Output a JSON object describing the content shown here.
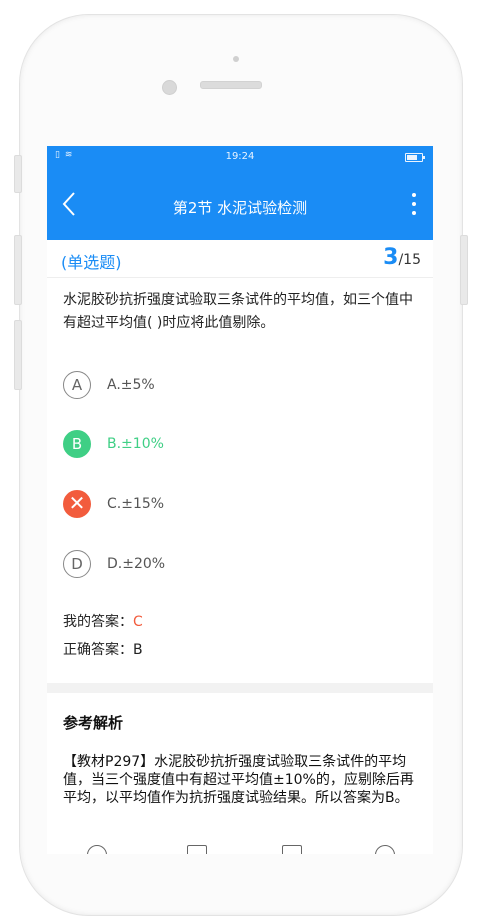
{
  "status_bar": {
    "left_icons": "▯ ≋",
    "time": "19:24"
  },
  "navbar": {
    "title": "第2节 水泥试验检测"
  },
  "question": {
    "type_label": "(单选题)",
    "current": "3",
    "total": "/15",
    "text": "水泥胶砂抗折强度试验取三条试件的平均值，如三个值中有超过平均值( )时应将此值剔除。",
    "options": [
      {
        "letter": "A",
        "text": "A.±5%",
        "state": "normal"
      },
      {
        "letter": "B",
        "text": "B.±10%",
        "state": "correct"
      },
      {
        "letter": "✕",
        "text": "C.±15%",
        "state": "wrong"
      },
      {
        "letter": "D",
        "text": "D.±20%",
        "state": "normal"
      }
    ]
  },
  "answers": {
    "my_label": "我的答案：",
    "my_value": "C",
    "correct_label": "正确答案：",
    "correct_value": "B"
  },
  "analysis": {
    "title": "参考解析",
    "body": "【教材P297】水泥胶砂抗折强度试验取三条试件的平均值，当三个强度值中有超过平均值±10%的，应剔除后再平均，以平均值作为抗折强度试验结果。所以答案为B。"
  },
  "colors": {
    "primary": "#1a8cf5",
    "correct": "#3fcf85",
    "wrong": "#f25c3d"
  }
}
